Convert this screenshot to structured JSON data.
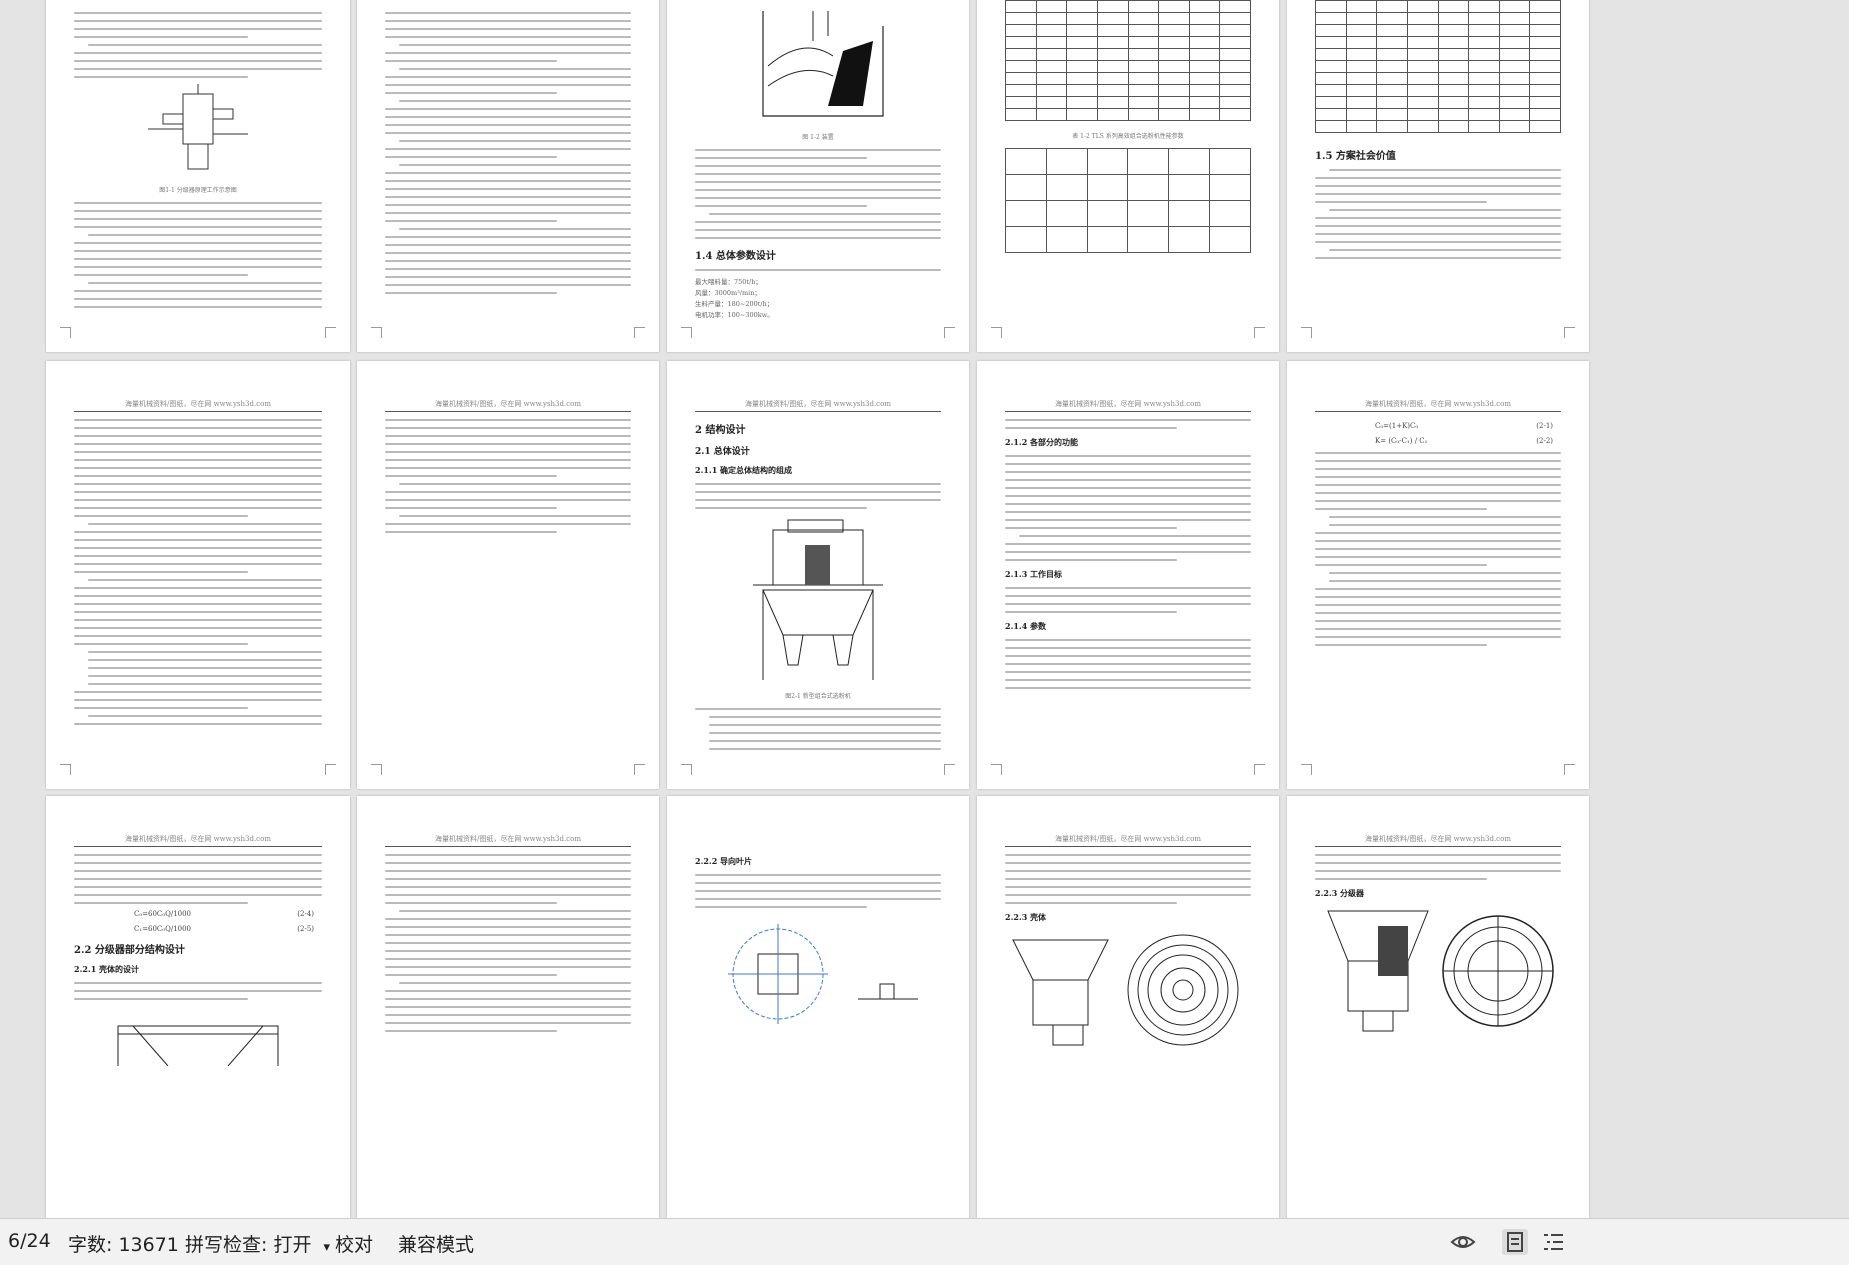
{
  "document": {
    "watermark_header": "海量机械资料/图纸，尽在网 www.ysh3d.com",
    "section_headings": {
      "p4_14": "1.4 总体参数设计",
      "p5_15": "1.5 方案社会价值",
      "p8_2": "2  结构设计",
      "p8_21": "2.1 总体设计",
      "p8_211": "2.1.1 确定总体结构的组成",
      "p9_212": "2.1.2 各部分的功能",
      "p9_213": "2.1.3 工作目标",
      "p9_214": "2.1.4 参数",
      "p11_22": "2.2 分级器部分结构设计",
      "p11_221": "2.2.1 壳体的设计",
      "p13_222": "2.2.2 导向叶片",
      "p14_223": "2.2.3 壳体",
      "p15_223": "2.2.3 分级器"
    },
    "captions": {
      "p2_fig": "图1-1 分级器原理工作示意图",
      "p3_fig": "图 1-2 装置",
      "p4_table": "表 1-2 TLS 系列高效组合选粉机性能参数",
      "p8_fig": "图2-1 新型组合式选粉机"
    },
    "param_list": {
      "title": "1.4 总体参数设计",
      "items": [
        "最大喂料量：750t/h；",
        "风量：3000m³/min；",
        "生料产量：180~200t/h；",
        "电机功率：100~300kw。"
      ]
    },
    "formulas": {
      "f1": "C₀=(1+K)C₀",
      "f1_no": "(2-1)",
      "f2": "K= (C₀-C₁) / C₁",
      "f2_no": "(2-2)",
      "f3": "C₀=60C₀Q/1000",
      "f3_no": "(2-4)",
      "f4": "C₁=60C₀Q/1000",
      "f4_no": "(2-5)"
    }
  },
  "statusbar": {
    "page": "6/24",
    "word_count": "字数: 13671",
    "spell_check": "拼写检查: 打开",
    "proofread": "校对",
    "compat_mode": "兼容模式"
  }
}
